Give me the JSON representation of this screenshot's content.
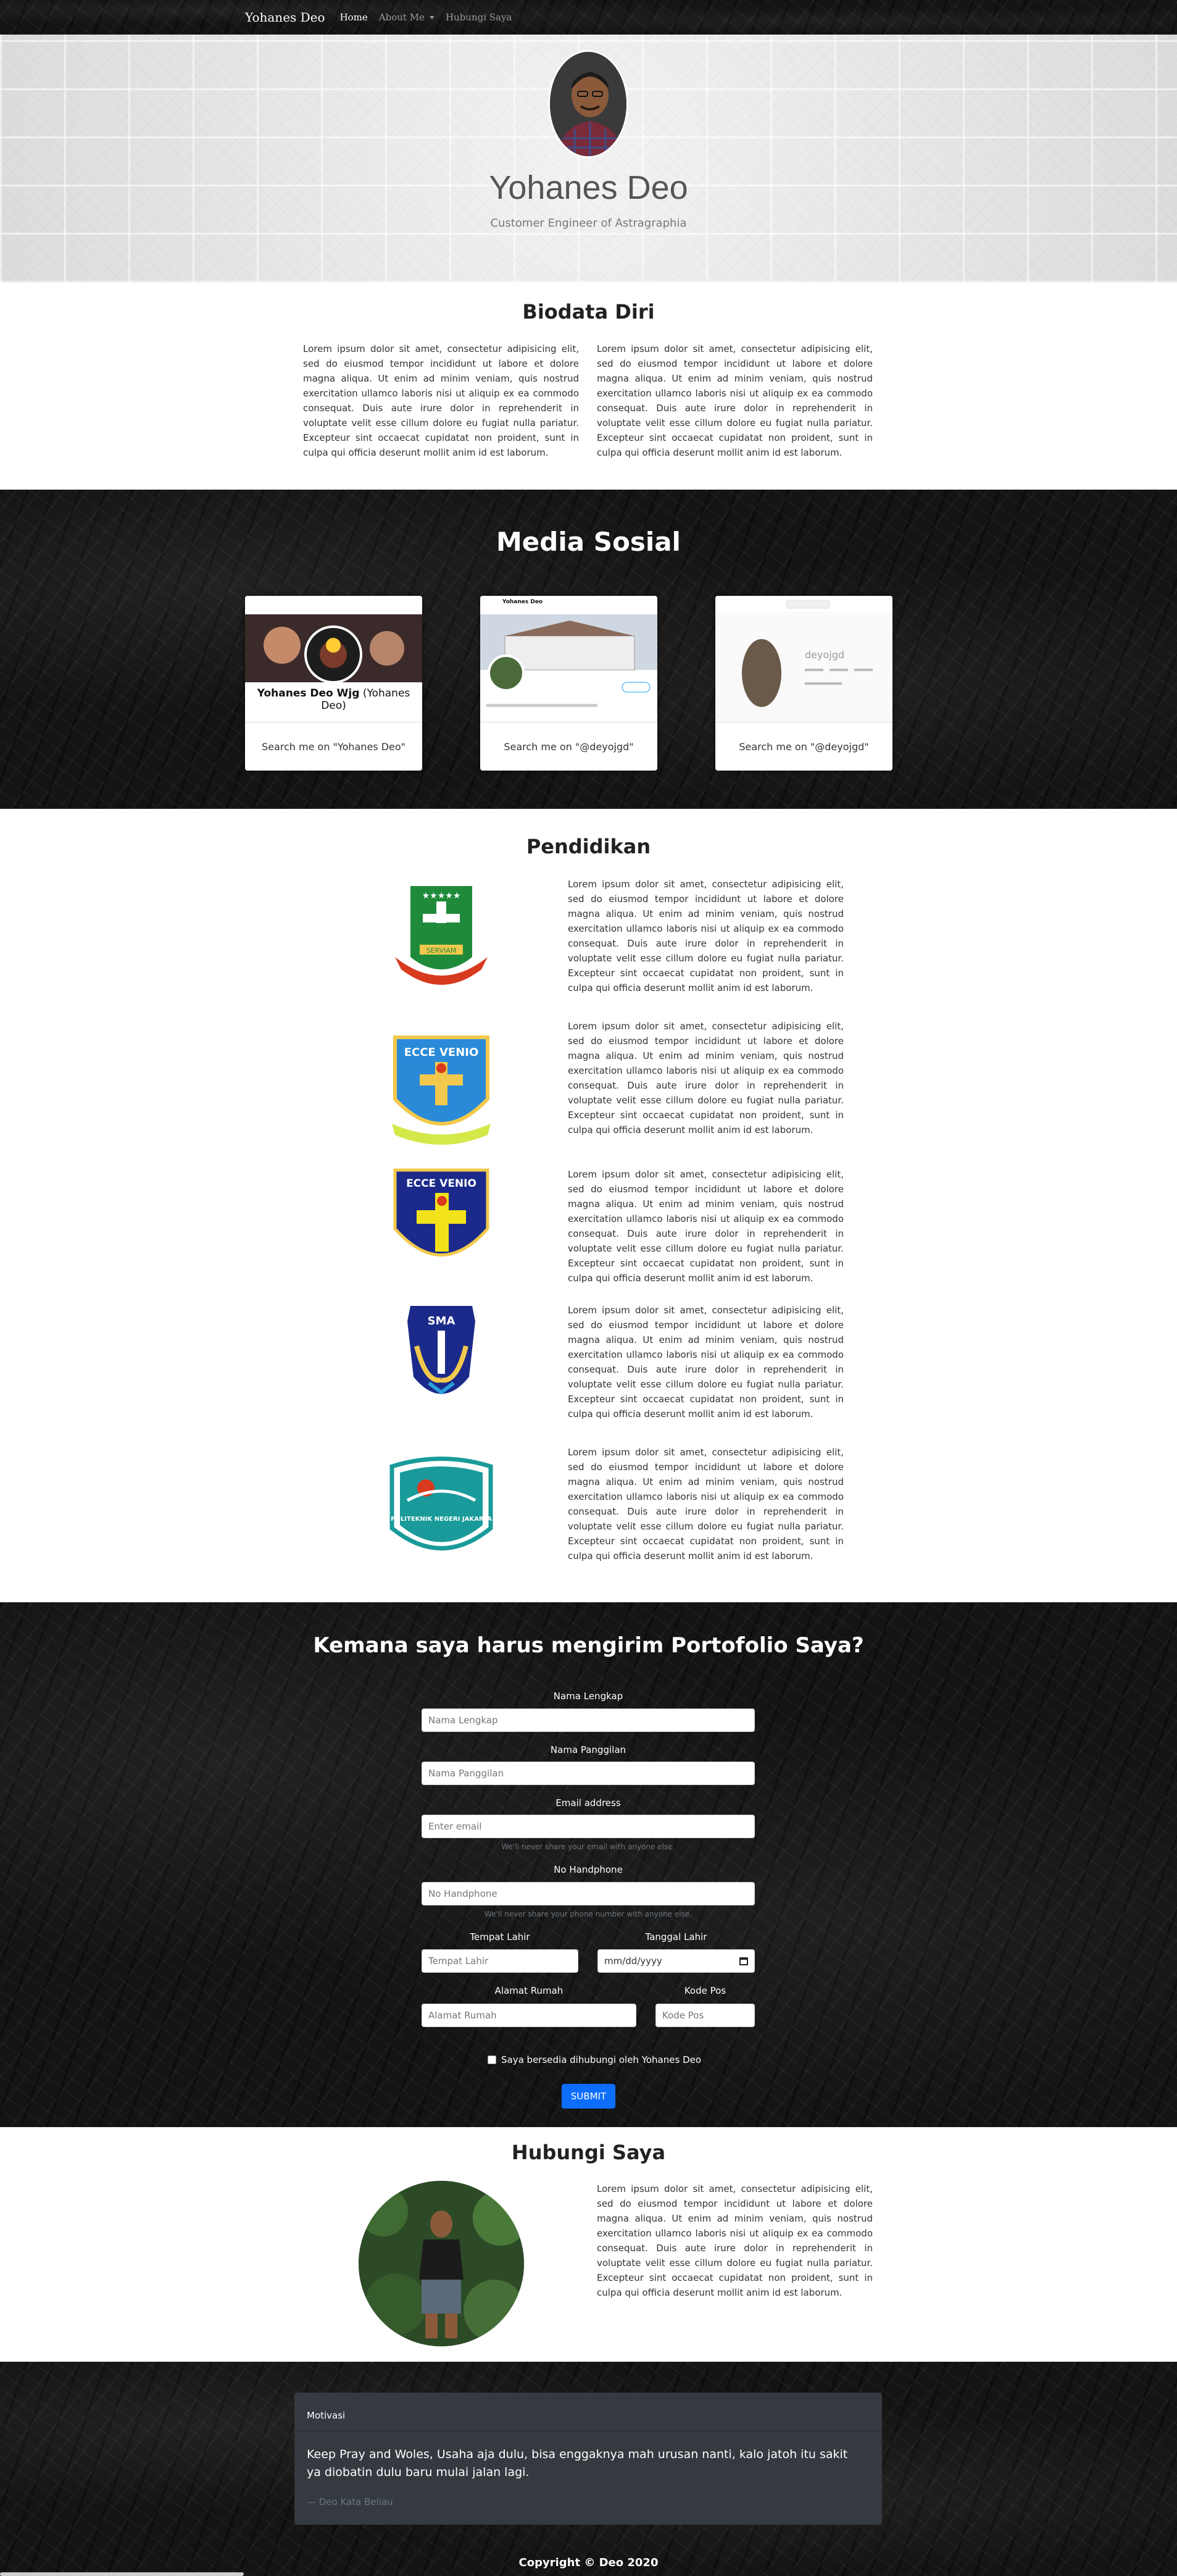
{
  "navbar": {
    "brand": "Yohanes Deo",
    "links": [
      {
        "label": "Home"
      },
      {
        "label": "About Me"
      },
      {
        "label": "Hubungi Saya"
      }
    ]
  },
  "hero": {
    "name": "Yohanes Deo",
    "role": "Customer Engineer of Astragraphia"
  },
  "biodata": {
    "title": "Biodata Diri",
    "col1": "Lorem ipsum dolor sit amet, consectetur adipisicing elit, sed do eiusmod tempor incididunt ut labore et dolore magna aliqua. Ut enim ad minim veniam, quis nostrud exercitation ullamco laboris nisi ut aliquip ex ea commodo consequat. Duis aute irure dolor in reprehenderit in voluptate velit esse cillum dolore eu fugiat nulla pariatur. Excepteur sint occaecat cupidatat non proident, sunt in culpa qui officia deserunt mollit anim id est laborum.",
    "col2": "Lorem ipsum dolor sit amet, consectetur adipisicing elit, sed do eiusmod tempor incididunt ut labore et dolore magna aliqua. Ut enim ad minim veniam, quis nostrud exercitation ullamco laboris nisi ut aliquip ex ea commodo consequat. Duis aute irure dolor in reprehenderit in voluptate velit esse cillum dolore eu fugiat nulla pariatur. Excepteur sint occaecat cupidatat non proident, sunt in culpa qui officia deserunt mollit anim id est laborum."
  },
  "social": {
    "title": "Media Sosial",
    "cards": [
      {
        "caption": "Search me on \"Yohanes Deo\"",
        "shot_title": "Yohanes Deo Wjg",
        "shot_sub": "(Yohanes Deo)"
      },
      {
        "caption": "Search me on \"@deyojgd\"",
        "shot_title": "Yohanes Deo"
      },
      {
        "caption": "Search me on \"@deyojgd\"",
        "shot_title": "deyojgd"
      }
    ]
  },
  "education": {
    "title": "Pendidikan",
    "items": [
      {
        "logo_name": "serviam-crest",
        "logo_text": "SERVIAM",
        "text": "Lorem ipsum dolor sit amet, consectetur adipisicing elit, sed do eiusmod tempor incididunt ut labore et dolore magna aliqua. Ut enim ad minim veniam, quis nostrud exercitation ullamco laboris nisi ut aliquip ex ea commodo consequat. Duis aute irure dolor in reprehenderit in voluptate velit esse cillum dolore eu fugiat nulla pariatur. Excepteur sint occaecat cupidatat non proident, sunt in culpa qui officia deserunt mollit anim id est laborum."
      },
      {
        "logo_name": "ecce-venio-sd-crest",
        "logo_text": "ECCE VENIO",
        "text": "Lorem ipsum dolor sit amet, consectetur adipisicing elit, sed do eiusmod tempor incididunt ut labore et dolore magna aliqua. Ut enim ad minim veniam, quis nostrud exercitation ullamco laboris nisi ut aliquip ex ea commodo consequat. Duis aute irure dolor in reprehenderit in voluptate velit esse cillum dolore eu fugiat nulla pariatur. Excepteur sint occaecat cupidatat non proident, sunt in culpa qui officia deserunt mollit anim id est laborum."
      },
      {
        "logo_name": "ecce-venio-smp-crest",
        "logo_text": "ECCE VENIO",
        "text": "Lorem ipsum dolor sit amet, consectetur adipisicing elit, sed do eiusmod tempor incididunt ut labore et dolore magna aliqua. Ut enim ad minim veniam, quis nostrud exercitation ullamco laboris nisi ut aliquip ex ea commodo consequat. Duis aute irure dolor in reprehenderit in voluptate velit esse cillum dolore eu fugiat nulla pariatur. Excepteur sint occaecat cupidatat non proident, sunt in culpa qui officia deserunt mollit anim id est laborum."
      },
      {
        "logo_name": "sma-crest",
        "logo_text": "SMA",
        "text": "Lorem ipsum dolor sit amet, consectetur adipisicing elit, sed do eiusmod tempor incididunt ut labore et dolore magna aliqua. Ut enim ad minim veniam, quis nostrud exercitation ullamco laboris nisi ut aliquip ex ea commodo consequat. Duis aute irure dolor in reprehenderit in voluptate velit esse cillum dolore eu fugiat nulla pariatur. Excepteur sint occaecat cupidatat non proident, sunt in culpa qui officia deserunt mollit anim id est laborum."
      },
      {
        "logo_name": "politeknik-negeri-jakarta-crest",
        "logo_text": "POLITEKNIK NEGERI JAKARTA",
        "text": "Lorem ipsum dolor sit amet, consectetur adipisicing elit, sed do eiusmod tempor incididunt ut labore et dolore magna aliqua. Ut enim ad minim veniam, quis nostrud exercitation ullamco laboris nisi ut aliquip ex ea commodo consequat. Duis aute irure dolor in reprehenderit in voluptate velit esse cillum dolore eu fugiat nulla pariatur. Excepteur sint occaecat cupidatat non proident, sunt in culpa qui officia deserunt mollit anim id est laborum."
      }
    ]
  },
  "form": {
    "title": "Kemana saya harus mengirim Portofolio Saya?",
    "nama_lengkap": {
      "label": "Nama Lengkap",
      "placeholder": "Nama Lengkap"
    },
    "nama_panggilan": {
      "label": "Nama Panggilan",
      "placeholder": "Nama Panggilan"
    },
    "email": {
      "label": "Email address",
      "placeholder": "Enter email",
      "hint": "We'll never share your email with anyone else."
    },
    "phone": {
      "label": "No Handphone",
      "placeholder": "No Handphone",
      "hint": "We'll never share your phone number with anyone else."
    },
    "tempat_lahir": {
      "label": "Tempat Lahir",
      "placeholder": "Tempat Lahir"
    },
    "tanggal_lahir": {
      "label": "Tanggal Lahir",
      "placeholder": "mm/dd/yyyy"
    },
    "alamat": {
      "label": "Alamat Rumah",
      "placeholder": "Alamat Rumah"
    },
    "kode_pos": {
      "label": "Kode Pos",
      "placeholder": "Kode Pos"
    },
    "consent": "Saya bersedia dihubungi oleh Yohanes Deo",
    "submit": "SUBMIT"
  },
  "contact": {
    "title": "Hubungi Saya",
    "text": "Lorem ipsum dolor sit amet, consectetur adipisicing elit, sed do eiusmod tempor incididunt ut labore et dolore magna aliqua. Ut enim ad minim veniam, quis nostrud exercitation ullamco laboris nisi ut aliquip ex ea commodo consequat. Duis aute irure dolor in reprehenderit in voluptate velit esse cillum dolore eu fugiat nulla pariatur. Excepteur sint occaecat cupidatat non proident, sunt in culpa qui officia deserunt mollit anim id est laborum."
  },
  "footer": {
    "quote_title": "Motivasi",
    "quote": "Keep Pray and Woles, Usaha aja dulu, bisa enggaknya mah urusan nanti, kalo jatoh itu sakit ya diobatin dulu baru mulai jalan lagi.",
    "quote_by": "— Deo Kata Beliau",
    "copyright": "Copyright © Deo 2020"
  },
  "colors": {
    "primary": "#0d6efd",
    "card_dark": "#343a40"
  }
}
